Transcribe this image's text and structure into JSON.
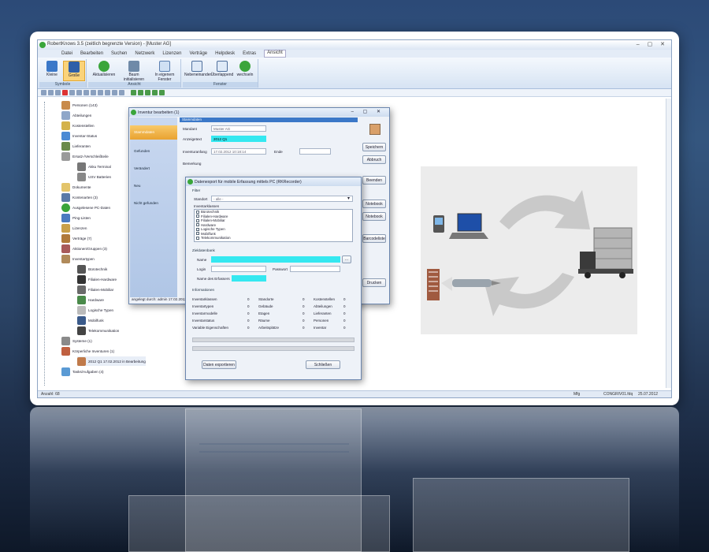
{
  "window": {
    "title": "RobertKnows 3.5 (zeitlich begrenzte Version) - [Muster AG]",
    "controls": "– ▢ ✕"
  },
  "menu": [
    "Datei",
    "Bearbeiten",
    "Suchen",
    "Netzwerk",
    "Lizenzen",
    "Verträge",
    "Helpdesk",
    "Extras",
    "Ansicht"
  ],
  "ribbon": {
    "groups": [
      {
        "label": "Symbole",
        "buttons": [
          "Kleine",
          "Große"
        ]
      },
      {
        "label": "Ansicht",
        "buttons": [
          "Aktualisieren",
          "Baum initialisieren",
          "In eigenem Fenster"
        ]
      },
      {
        "label": "Fenster",
        "buttons": [
          "Nebeneinander",
          "Überlappend",
          "wechseln"
        ]
      }
    ]
  },
  "tree": [
    {
      "label": "Personen (143)",
      "icon": "people-icon"
    },
    {
      "label": "Abteilungen",
      "icon": "department-icon"
    },
    {
      "label": "Kostenstellen",
      "icon": "costcenter-icon"
    },
    {
      "label": "Inventar-Status",
      "icon": "status-icon"
    },
    {
      "label": "Lieferanten",
      "icon": "supplier-icon"
    },
    {
      "label": "Ersatz-/Verschleißteile",
      "icon": "parts-icon"
    },
    {
      "label": "Akku Terminal",
      "icon": "terminal-icon"
    },
    {
      "label": "USV Batterien",
      "icon": "battery-icon"
    },
    {
      "label": "Dokumente",
      "icon": "document-icon"
    },
    {
      "label": "Kontenarten (3)",
      "icon": "account-icon"
    },
    {
      "label": "Ausgelesene PC-Daten",
      "icon": "pc-data-icon"
    },
    {
      "label": "Ping-Listen",
      "icon": "ping-icon"
    },
    {
      "label": "Lizenzen",
      "icon": "license-icon"
    },
    {
      "label": "Verträge (7)",
      "icon": "contract-icon"
    },
    {
      "label": "Aktionen/Gruppen (3)",
      "icon": "actions-icon"
    },
    {
      "label": "Inventartypen",
      "icon": "inventory-types-icon"
    },
    {
      "label": "Bürotechnik",
      "icon": "office-tech-icon"
    },
    {
      "label": "Filialen-Hardware",
      "icon": "branch-hardware-icon"
    },
    {
      "label": "Filialen-Mobiliar",
      "icon": "branch-furniture-icon"
    },
    {
      "label": "Hardware",
      "icon": "hardware-icon"
    },
    {
      "label": "Logische Typen",
      "icon": "logical-types-icon"
    },
    {
      "label": "Mobilfunk",
      "icon": "mobile-icon"
    },
    {
      "label": "Telekommunikation",
      "icon": "telecom-icon"
    },
    {
      "label": "Systeme (1)",
      "icon": "systems-icon"
    },
    {
      "label": "Körperliche Inventuren (1)",
      "icon": "physical-inventory-icon"
    },
    {
      "label": "2012 Q1 17.02.2012 in Bearbeitung",
      "icon": "inventory-item-icon"
    },
    {
      "label": "Tasks/Aufgaben (4)",
      "icon": "tasks-icon"
    }
  ],
  "status": {
    "left": "Anzahl: 68",
    "mid": "Mfg",
    "db": "CONGRIV01.fdq",
    "date": "25.07.2012"
  },
  "inventur_dialog": {
    "title": "Inventur bearbeiten (1)",
    "nav": [
      "Stammdaten",
      "Gefunden",
      "Verändert",
      "Neu",
      "Nicht gefunden"
    ],
    "section": "Stammdaten",
    "mandant_label": "Mandant",
    "mandant_value": "Muster AG",
    "anzeigetext_label": "Anzeigetext",
    "anzeigetext_value": "2012 Q1",
    "inventuranfang_label": "Inventuranfang",
    "inventuranfang_value": "17.02.2012 10:18:14",
    "ende_label": "Ende",
    "bemerkung_label": "Bemerkung",
    "buttons": [
      "Speichern",
      "Abbruch",
      "Beenden",
      "Notebook",
      "Notebook",
      "Barcodeliste",
      "Drucken"
    ],
    "footer": "angelegt durch: admin 17.02.2012"
  },
  "export_dialog": {
    "title": "Datenexport für mobile Erfassung mittels PC (RKRecorder)",
    "filter_section": "Filter",
    "standort_label": "Standort",
    "standort_value": "- alle -",
    "inventarklassen_label": "Inventarklassen",
    "classes": [
      "Bürotechnik",
      "Filialen-Hardware",
      "Filialen-Mobiliar",
      "Hardware",
      "Logische Typen",
      "Mobilfunk",
      "Telekommunikation"
    ],
    "ziel_section": "Zieldatenbank",
    "name_label": "Name",
    "login_label": "Login",
    "passwort_label": "Passwort",
    "erfasser_label": "Name des Erfassers",
    "browse_label": "...",
    "info_section": "Informationen",
    "info_rows": [
      [
        "Inventarklassen",
        "0",
        "Standorte",
        "0",
        "Kostenstellen",
        "0"
      ],
      [
        "Inventartypen",
        "0",
        "Gebäude",
        "0",
        "Abteilungen",
        "0"
      ],
      [
        "Inventarmodelle",
        "0",
        "Etagen",
        "0",
        "Lieferanten",
        "0"
      ],
      [
        "Inventarstatus",
        "0",
        "Räume",
        "0",
        "Personen",
        "0"
      ],
      [
        "Variable Eigenschaften",
        "0",
        "Arbeitsplätze",
        "0",
        "Inventar",
        "0"
      ]
    ],
    "export_button": "Daten exportieren",
    "close_button": "Schließen"
  },
  "colors": {
    "accent": "#35e8f0",
    "selected_nav": "#f0b445",
    "titlebar": "#dbe6f4"
  }
}
